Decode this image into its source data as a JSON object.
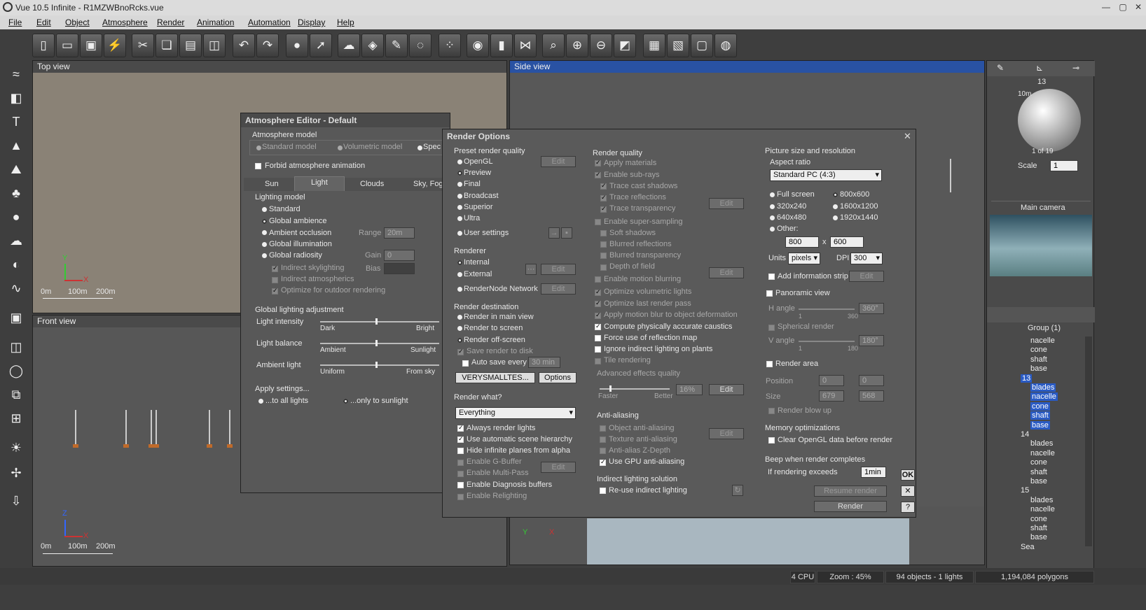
{
  "window": {
    "title": "Vue 10.5 Infinite - R1MZWBnoRcks.vue",
    "min": "—",
    "max": "▢",
    "close": "✕"
  },
  "menu": [
    "File",
    "Edit",
    "Object",
    "Atmosphere",
    "Render",
    "Animation",
    "Automation",
    "Display",
    "Help"
  ],
  "toolbar_icons": [
    "new-icon",
    "open-icon",
    "save-icon",
    "quick-render-icon",
    "cut-icon",
    "copy-icon",
    "paste-icon",
    "duplicate-icon",
    "undo-icon",
    "redo-icon",
    "link-icon",
    "point-icon",
    "atmosphere-icon",
    "material-icon",
    "paint-icon",
    "globe-icon",
    "palette-icon",
    "render-icon",
    "bars-icon",
    "flip-icon",
    "zoom-region-icon",
    "zoom-in-icon",
    "zoom-out-icon",
    "fit-icon",
    "film-icon",
    "clapper-icon",
    "frame-icon",
    "camera-icon"
  ],
  "viewports": {
    "top": {
      "title": "Top view"
    },
    "side": {
      "title": "Side view"
    },
    "front": {
      "title": "Front view"
    },
    "scale": {
      "s0": "0m",
      "s1": "100m",
      "s2": "200m"
    },
    "axis_top": {
      "y": "Y",
      "x": "X"
    },
    "axis_front": {
      "z": "Z",
      "x": "X"
    },
    "axis_side": {
      "y": "Y",
      "x": "X"
    }
  },
  "atmo": {
    "title": "Atmosphere Editor - Default",
    "model_label": "Atmosphere model",
    "models": [
      "Standard model",
      "Volumetric model",
      "Spec"
    ],
    "forbid": "Forbid atmosphere animation",
    "tabs": [
      "Sun",
      "Light",
      "Clouds",
      "Sky, Fog"
    ],
    "lighting_model": "Lighting model",
    "lm": [
      "Standard",
      "Global ambience",
      "Ambient occlusion",
      "Global illumination",
      "Global radiosity"
    ],
    "range_label": "Range",
    "range_val": "20m",
    "gain_label": "Gain",
    "gain_val": "0",
    "bias_label": "Bias",
    "sub": [
      "Indirect skylighting",
      "Indirect atmospherics",
      "Optimize for outdoor rendering"
    ],
    "gla": "Global lighting adjustment",
    "intensity": "Light intensity",
    "dark": "Dark",
    "bright": "Bright",
    "balance": "Light balance",
    "ambient": "Ambient",
    "sunlight": "Sunlight",
    "ambient_light": "Ambient light",
    "uniform": "Uniform",
    "fromsky": "From sky",
    "apply": "Apply settings...",
    "all": "...to all lights",
    "sun": "...only to sunlight"
  },
  "render": {
    "title": "Render Options",
    "preset_label": "Preset render quality",
    "presets": [
      "OpenGL",
      "Preview",
      "Final",
      "Broadcast",
      "Superior",
      "Ultra",
      "User settings"
    ],
    "edit": "Edit",
    "renderer_label": "Renderer",
    "renderers": [
      "Internal",
      "External",
      "RenderNode Network"
    ],
    "dest_label": "Render destination",
    "dests": [
      "Render in main view",
      "Render to screen",
      "Render off-screen"
    ],
    "save_disk": "Save render to disk",
    "auto_save": "Auto save every",
    "auto_save_val": "30 min",
    "file_btn": "VERYSMALLTES...",
    "options_btn": "Options",
    "what_label": "Render what?",
    "what_val": "Everything",
    "what_opts": [
      "Always render lights",
      "Use automatic scene hierarchy",
      "Hide infinite planes from alpha",
      "Enable G-Buffer",
      "Enable Multi-Pass",
      "Enable Diagnosis buffers",
      "Enable Relighting"
    ],
    "quality_label": "Render quality",
    "quality": [
      "Apply materials",
      "Enable sub-rays",
      "Trace cast shadows",
      "Trace reflections",
      "Trace transparency",
      "Enable super-sampling",
      "Soft shadows",
      "Blurred reflections",
      "Blurred transparency",
      "Depth of field",
      "Enable motion blurring",
      "Optimize volumetric lights",
      "Optimize last render pass",
      "Apply motion blur to object deformation",
      "Compute physically accurate caustics",
      "Force use of reflection map",
      "Ignore indirect lighting on plants",
      "Tile rendering"
    ],
    "adv_label": "Advanced effects quality",
    "faster": "Faster",
    "better": "Better",
    "adv_val": "16%",
    "aa_label": "Anti-aliasing",
    "aa": [
      "Object anti-aliasing",
      "Texture anti-aliasing",
      "Anti-alias Z-Depth",
      "Use GPU anti-aliasing"
    ],
    "ils_label": "Indirect lighting solution",
    "reuse": "Re-use indirect lighting",
    "pic_label": "Picture size and resolution",
    "aspect_label": "Aspect ratio",
    "aspect_val": "Standard PC (4:3)",
    "sizes": [
      "Full screen",
      "800x600",
      "320x240",
      "1600x1200",
      "640x480",
      "1920x1440",
      "Other:"
    ],
    "w": "800",
    "h": "600",
    "x": "x",
    "units_label": "Units",
    "units_val": "pixels",
    "dpi_label": "DPI",
    "dpi_val": "300",
    "info_strip": "Add information strip",
    "pano": "Panoramic view",
    "h_angle": "H angle",
    "h_val": "360°",
    "h_min": "1",
    "h_max": "360",
    "spherical": "Spherical render",
    "v_angle": "V angle",
    "v_val": "180°",
    "v_min": "1",
    "v_max": "180",
    "area": "Render area",
    "position": "Position",
    "size": "Size",
    "px": "0",
    "py": "0",
    "sx": "679",
    "sy": "568",
    "blowup": "Render blow up",
    "mem_label": "Memory optimizations",
    "clear_gl": "Clear OpenGL data before render",
    "beep_label": "Beep when render completes",
    "beep_if": "If rendering exceeds",
    "beep_val": "1min",
    "resume": "Resume render",
    "render_btn": "Render",
    "ok": "OK",
    "cancel": "✕",
    "help": "?"
  },
  "right": {
    "frame": "13",
    "dist": "10m",
    "mat_count": "1 of 19",
    "scale_label": "Scale",
    "scale_val": "1",
    "camera": "Main camera",
    "group": "Group (1)",
    "tree": [
      {
        "t": "nacelle",
        "hl": false,
        "d": 1
      },
      {
        "t": "cone",
        "hl": false,
        "d": 1
      },
      {
        "t": "shaft",
        "hl": false,
        "d": 1
      },
      {
        "t": "base",
        "hl": false,
        "d": 1
      },
      {
        "t": "13",
        "hl": true,
        "d": 0
      },
      {
        "t": "blades",
        "hl": true,
        "d": 1
      },
      {
        "t": "nacelle",
        "hl": true,
        "d": 1
      },
      {
        "t": "cone",
        "hl": true,
        "d": 1
      },
      {
        "t": "shaft",
        "hl": true,
        "d": 1
      },
      {
        "t": "base",
        "hl": true,
        "d": 1
      },
      {
        "t": "14",
        "hl": false,
        "d": 0
      },
      {
        "t": "blades",
        "hl": false,
        "d": 1
      },
      {
        "t": "nacelle",
        "hl": false,
        "d": 1
      },
      {
        "t": "cone",
        "hl": false,
        "d": 1
      },
      {
        "t": "shaft",
        "hl": false,
        "d": 1
      },
      {
        "t": "base",
        "hl": false,
        "d": 1
      },
      {
        "t": "15",
        "hl": false,
        "d": 0
      },
      {
        "t": "blades",
        "hl": false,
        "d": 1
      },
      {
        "t": "nacelle",
        "hl": false,
        "d": 1
      },
      {
        "t": "cone",
        "hl": false,
        "d": 1
      },
      {
        "t": "shaft",
        "hl": false,
        "d": 1
      },
      {
        "t": "base",
        "hl": false,
        "d": 1
      },
      {
        "t": "Sea",
        "hl": false,
        "d": 0
      }
    ]
  },
  "status": {
    "cpu": "4 CPU",
    "zoom": "Zoom : 45%",
    "objects": "94 objects - 1 lights",
    "polys": "1,194,084 polygons"
  },
  "colors": {
    "accent": "#2952a3",
    "selected": "#2a5bc4",
    "ground": "#8a8276"
  }
}
